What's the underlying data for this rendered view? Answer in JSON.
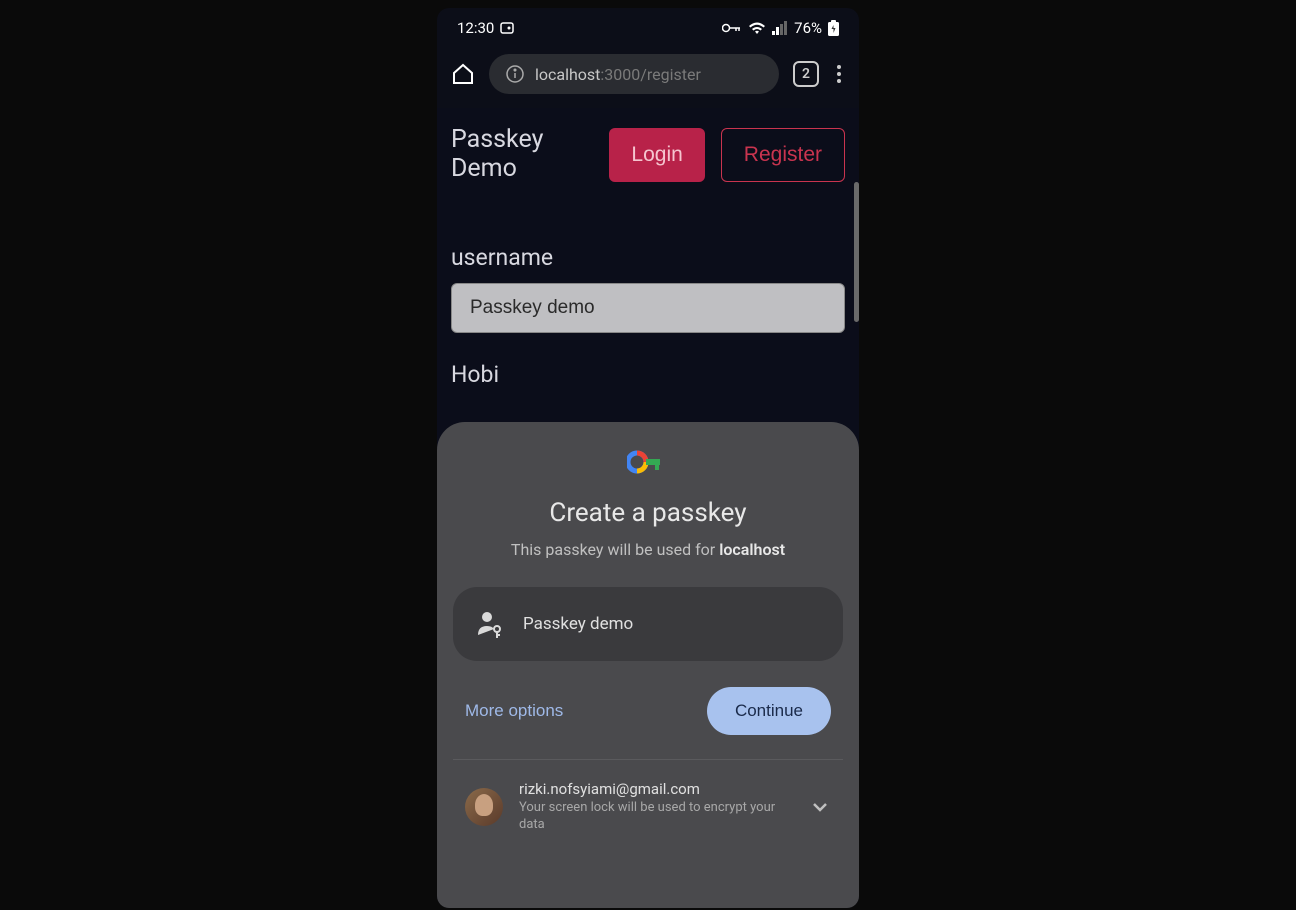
{
  "status_bar": {
    "time": "12:30",
    "battery": "76%"
  },
  "browser": {
    "url_host": "localhost",
    "url_path": ":3000/register",
    "tab_count": "2"
  },
  "app": {
    "title": "Passkey Demo",
    "login_label": "Login",
    "register_label": "Register"
  },
  "form": {
    "username_label": "username",
    "username_value": "Passkey demo",
    "hobi_label": "Hobi"
  },
  "sheet": {
    "title": "Create a passkey",
    "subtitle_prefix": "This passkey will be used for ",
    "subtitle_domain": "localhost",
    "passkey_name": "Passkey demo",
    "more_options_label": "More options",
    "continue_label": "Continue",
    "account_email": "rizki.nofsyiami@gmail.com",
    "account_desc": "Your screen lock will be used to encrypt your data"
  }
}
